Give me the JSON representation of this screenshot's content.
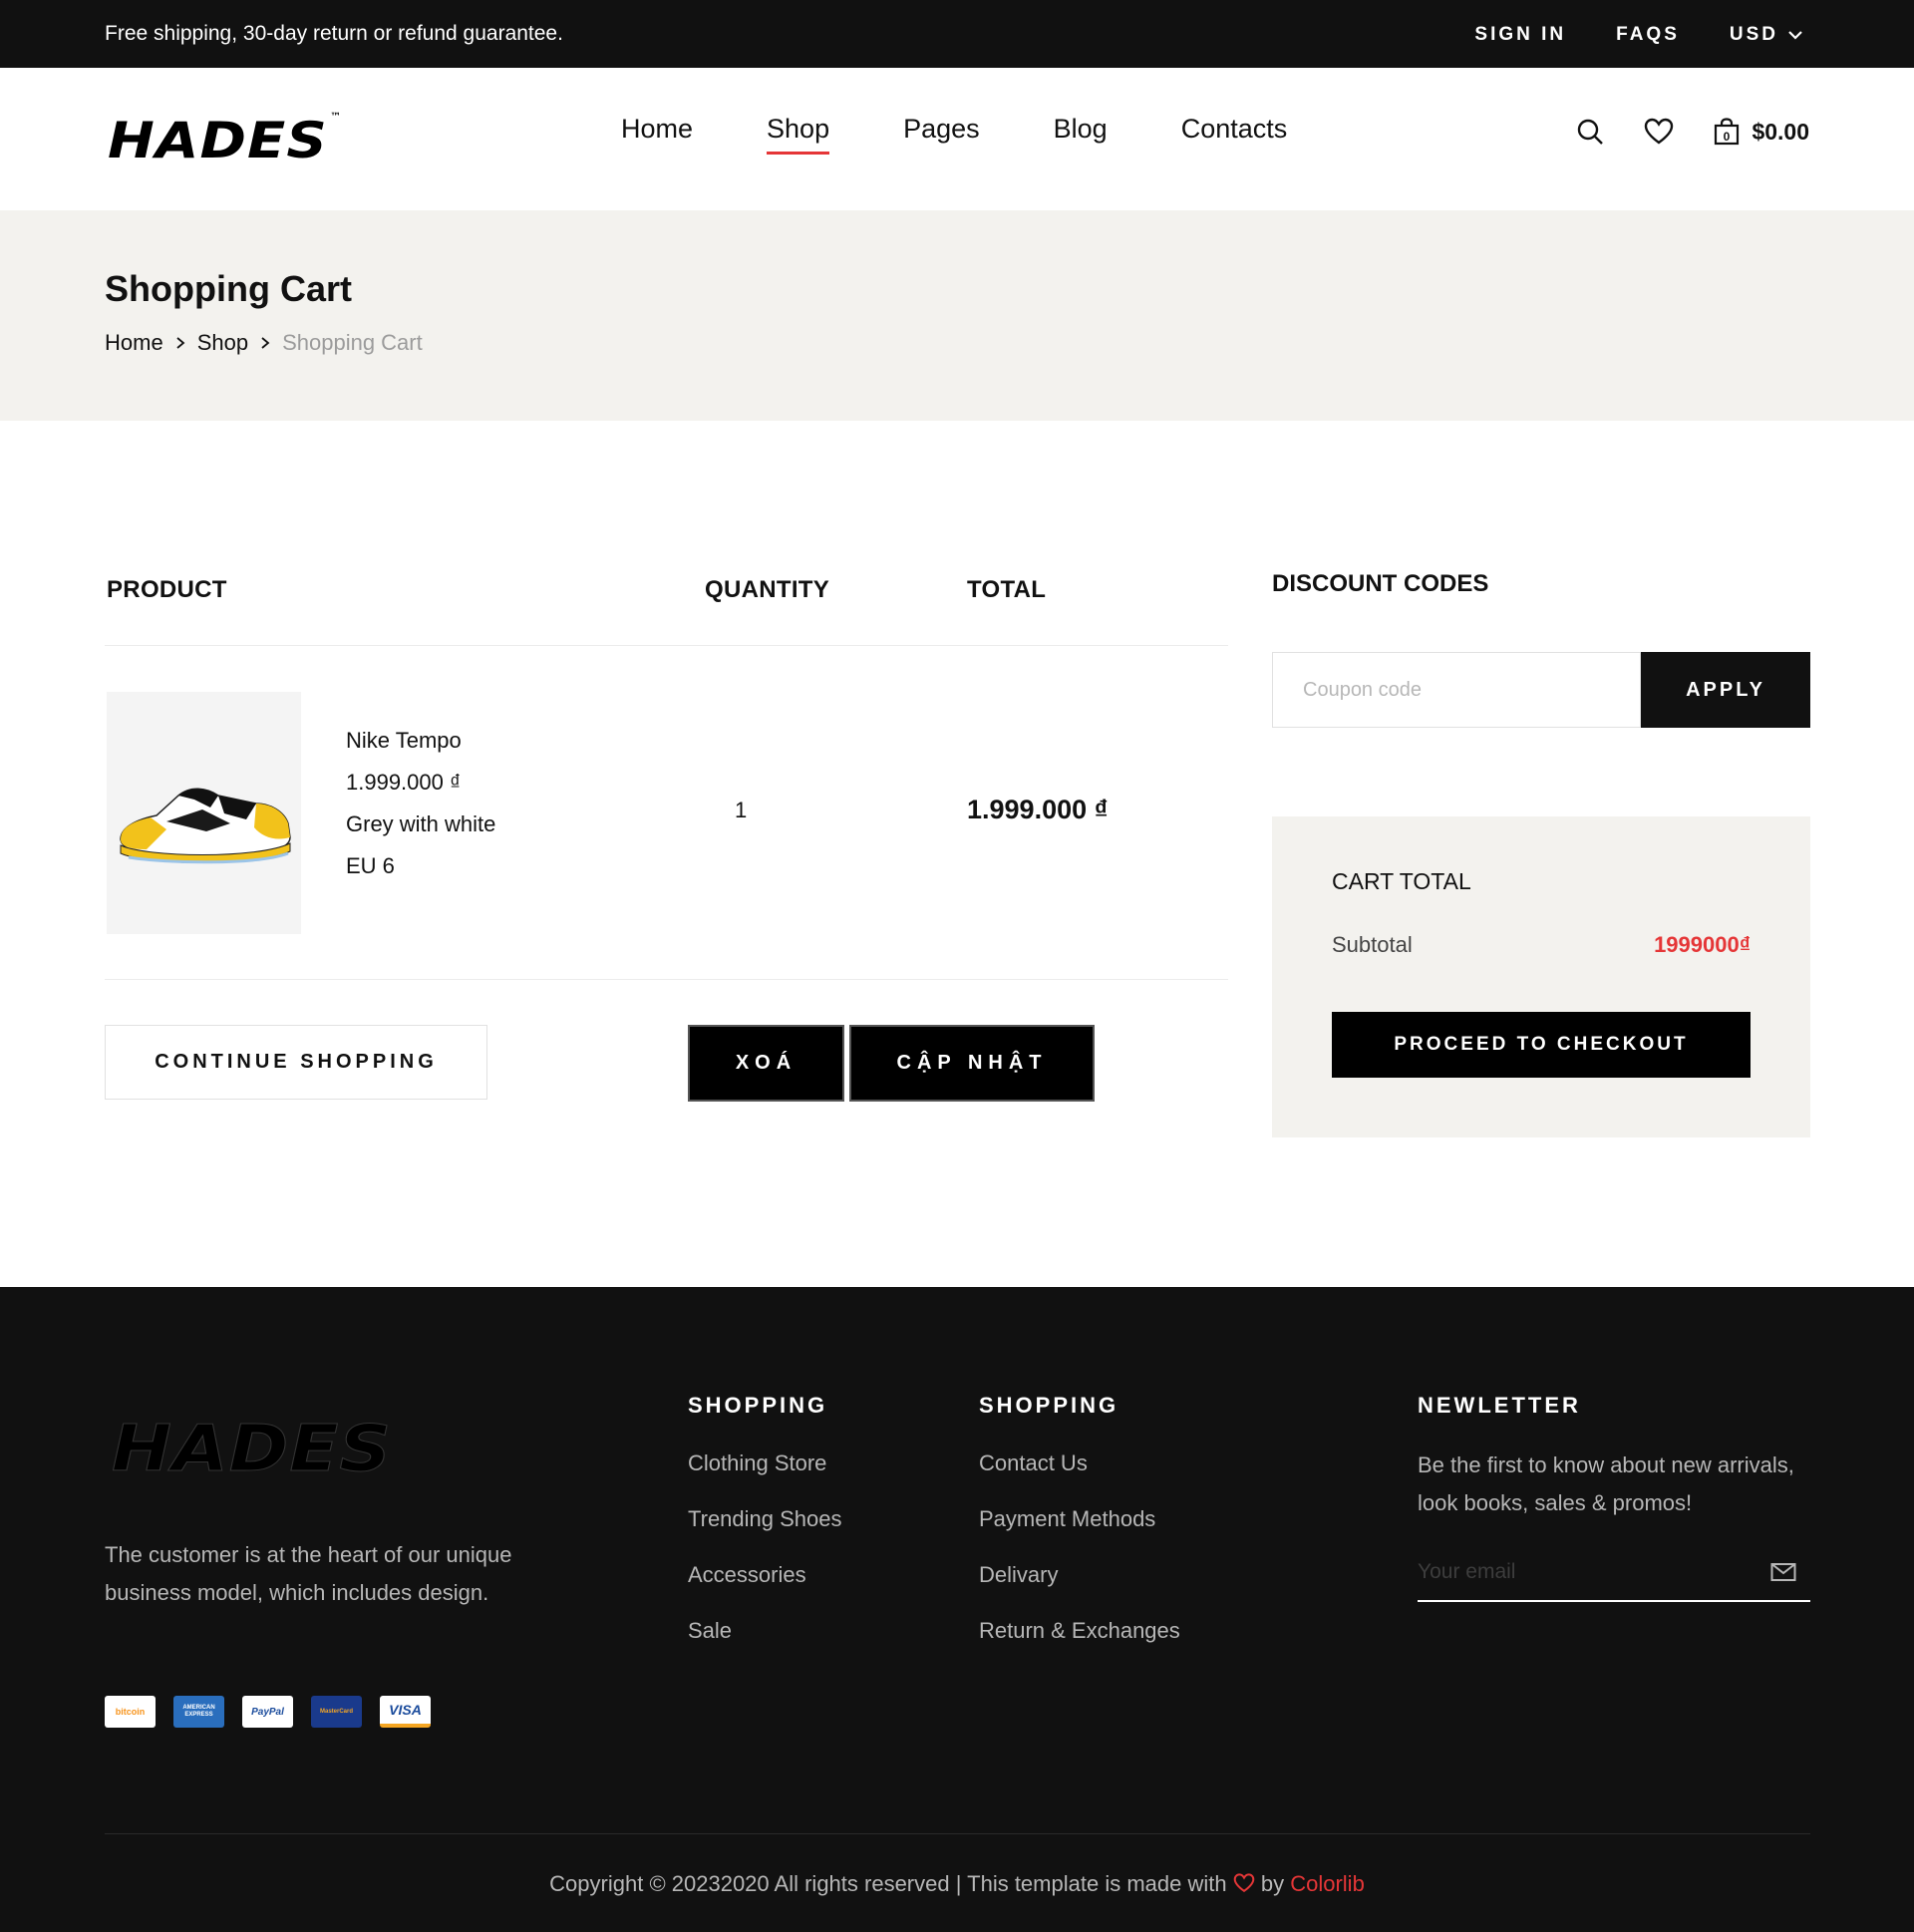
{
  "topbar": {
    "shipping": "Free shipping, 30-day return or refund guarantee.",
    "sign_in": "SIGN IN",
    "faqs": "FAQS",
    "currency": "USD"
  },
  "header": {
    "logo": "HADES",
    "logo_tm": "™",
    "nav": [
      {
        "label": "Home"
      },
      {
        "label": "Shop"
      },
      {
        "label": "Pages"
      },
      {
        "label": "Blog"
      },
      {
        "label": "Contacts"
      }
    ],
    "cart_amount": "$0.00",
    "cart_count": "0"
  },
  "breadcrumb": {
    "title": "Shopping Cart",
    "items": [
      "Home",
      "Shop",
      "Shopping Cart"
    ]
  },
  "cart": {
    "headers": {
      "product": "PRODUCT",
      "quantity": "QUANTITY",
      "total": "TOTAL"
    },
    "items": [
      {
        "name": "Nike Tempo",
        "price": "1.999.000 ₫",
        "color": "Grey with white",
        "size": "EU 6",
        "quantity": "1",
        "total": "1.999.000 ₫"
      }
    ],
    "continue": "CONTINUE SHOPPING",
    "delete": "XOÁ",
    "update": "CẬP NHẬT"
  },
  "discount": {
    "title": "DISCOUNT CODES",
    "placeholder": "Coupon code",
    "apply": "APPLY"
  },
  "cart_total": {
    "title": "CART TOTAL",
    "subtotal_label": "Subtotal",
    "subtotal_value": "1999000₫",
    "checkout": "PROCEED TO CHECKOUT"
  },
  "footer": {
    "logo": "HADES",
    "about": "The customer is at the heart of our unique business model, which includes design.",
    "payments": [
      "bitcoin",
      "AMERICAN EXPRESS",
      "PayPal",
      "MasterCard",
      "VISA"
    ],
    "col1": {
      "title": "SHOPPING",
      "links": [
        "Clothing Store",
        "Trending Shoes",
        "Accessories",
        "Sale"
      ]
    },
    "col2": {
      "title": "SHOPPING",
      "links": [
        "Contact Us",
        "Payment Methods",
        "Delivary",
        "Return & Exchanges"
      ]
    },
    "newsletter": {
      "title": "NEWLETTER",
      "text": "Be the first to know about new arrivals, look books, sales & promos!",
      "placeholder": "Your email"
    },
    "copyright_pre": "Copyright © 20232020 All rights reserved | This template is made with",
    "copyright_by": "by",
    "copyright_brand": "Colorlib"
  },
  "colors": {
    "accent": "#e53637",
    "dark": "#111111",
    "light_bg": "#f3f2ee"
  }
}
